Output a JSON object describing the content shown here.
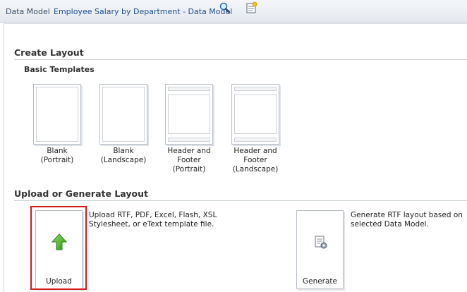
{
  "toolbar": {
    "data_model_label": "Data Model",
    "title": "Employee Salary by Department - Data Model",
    "icons": [
      "search-icon",
      "edit-icon"
    ]
  },
  "create_layout": {
    "title": "Create Layout",
    "basic_templates_title": "Basic Templates",
    "templates": [
      {
        "line1": "Blank",
        "line2": "(Portrait)"
      },
      {
        "line1": "Blank",
        "line2": "(Landscape)"
      },
      {
        "line1": "Header and",
        "line2": "Footer",
        "line3": "(Portrait)"
      },
      {
        "line1": "Header and",
        "line2": "Footer",
        "line3": "(Landscape)"
      }
    ]
  },
  "upload_generate": {
    "title": "Upload or Generate Layout",
    "upload": {
      "label": "Upload",
      "desc_line1": "Upload RTF, PDF, Excel, Flash, XSL",
      "desc_line2": "Stylesheet, or eText template file.",
      "icon": "upload-arrow-icon",
      "highlight_color": "#d41b1b"
    },
    "generate": {
      "label": "Generate",
      "desc_line1": "Generate RTF layout based on",
      "desc_line2": "selected Data Model.",
      "icon": "generate-document-icon"
    }
  }
}
